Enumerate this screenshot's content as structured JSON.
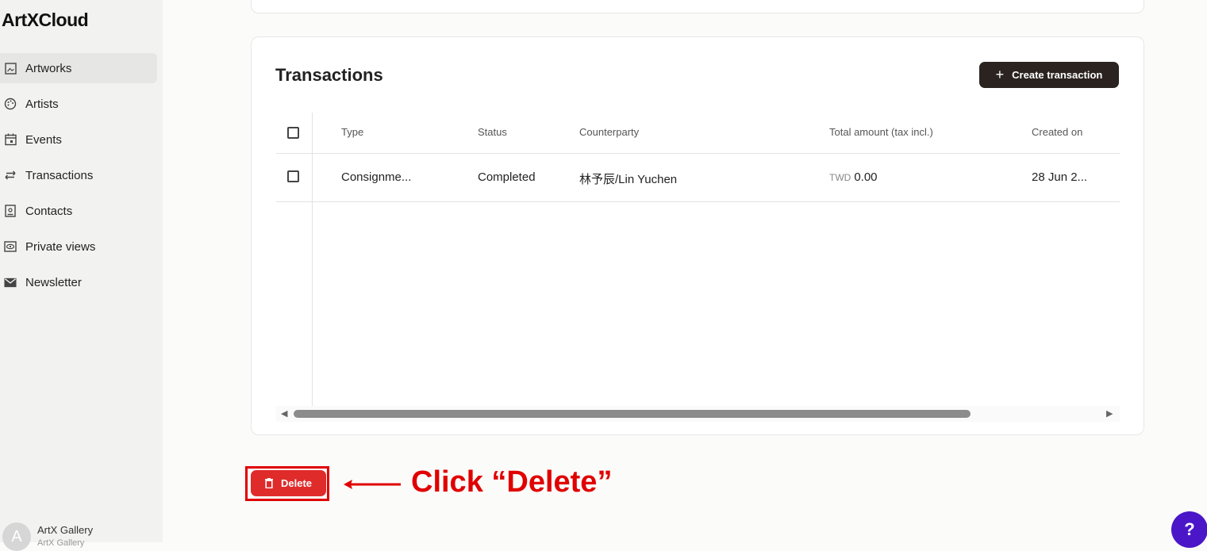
{
  "app": {
    "logo": "ArtXCloud"
  },
  "sidebar": {
    "items": [
      {
        "label": "Artworks",
        "icon": "image-icon"
      },
      {
        "label": "Artists",
        "icon": "palette-icon"
      },
      {
        "label": "Events",
        "icon": "calendar-icon"
      },
      {
        "label": "Transactions",
        "icon": "arrows-exchange-icon"
      },
      {
        "label": "Contacts",
        "icon": "contact-card-icon"
      },
      {
        "label": "Private views",
        "icon": "eye-icon"
      },
      {
        "label": "Newsletter",
        "icon": "mail-icon"
      }
    ],
    "active": "Artworks",
    "footer": {
      "avatar_letter": "A",
      "name": "ArtX Gallery",
      "subtitle": "ArtX Gallery"
    }
  },
  "transactions": {
    "title": "Transactions",
    "create_label": "Create transaction",
    "columns": [
      "Type",
      "Status",
      "Counterparty",
      "Total amount (tax incl.)",
      "Created on"
    ],
    "rows": [
      {
        "type": "Consignme...",
        "status": "Completed",
        "counterparty": "林予辰/Lin Yuchen",
        "currency": "TWD",
        "amount": "0.00",
        "created": "28 Jun 2..."
      }
    ]
  },
  "actions": {
    "delete_label": "Delete"
  },
  "annotation": {
    "text": "Click “Delete”",
    "color": "#e00000"
  },
  "help": {
    "label": "?"
  },
  "colors": {
    "primary_dark": "#2a2320",
    "danger": "#e02b2b",
    "help": "#4a16c8"
  }
}
